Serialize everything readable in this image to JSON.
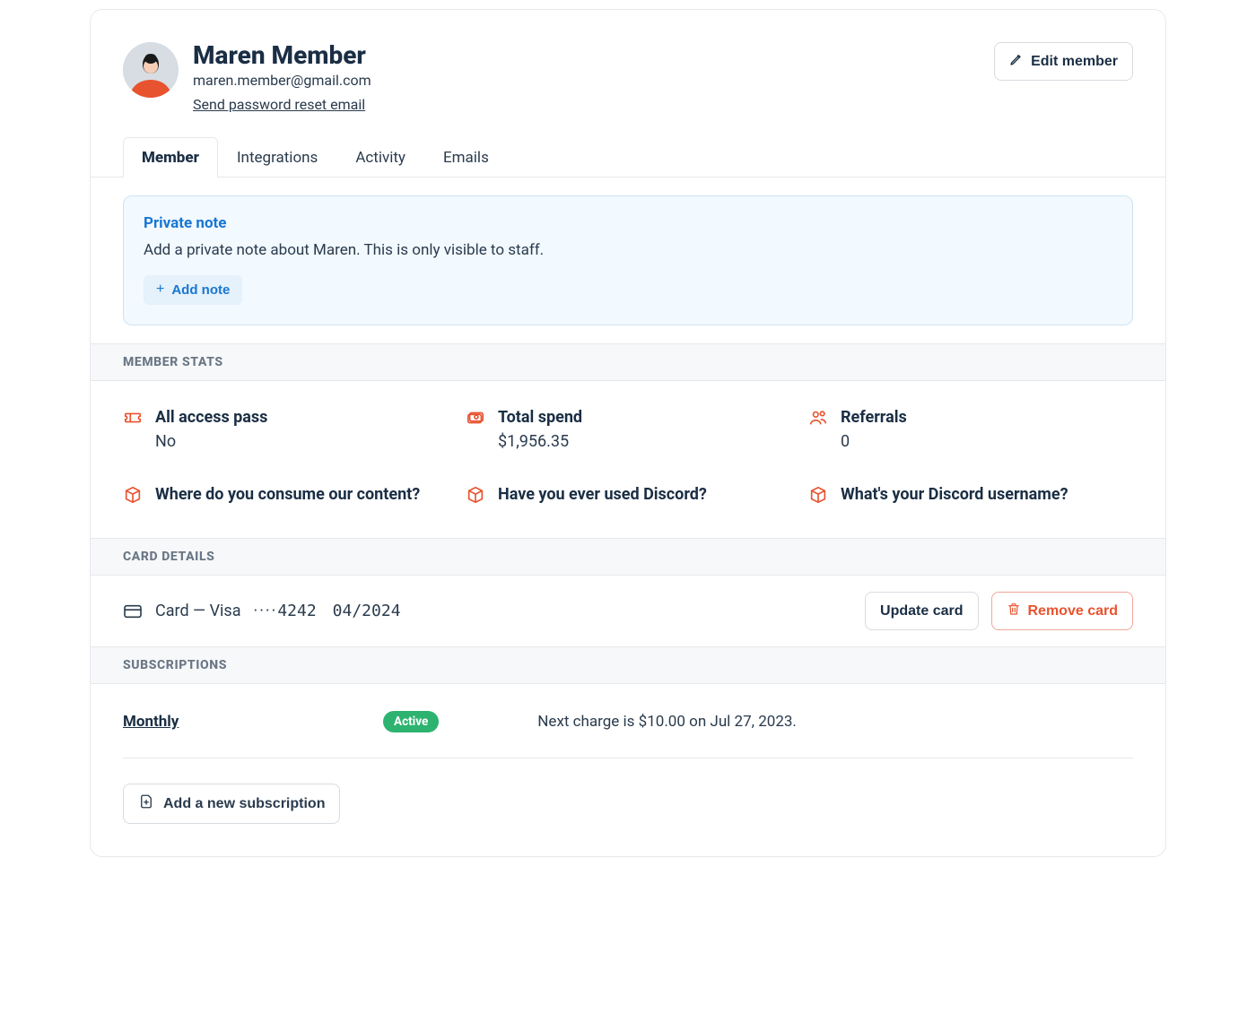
{
  "header": {
    "name": "Maren Member",
    "email": "maren.member@gmail.com",
    "reset_link": "Send password reset email",
    "edit_button": "Edit member"
  },
  "tabs": {
    "member": "Member",
    "integrations": "Integrations",
    "activity": "Activity",
    "emails": "Emails"
  },
  "note": {
    "title": "Private note",
    "description": "Add a private note about Maren. This is only visible to staff.",
    "add_button": "Add note"
  },
  "sections": {
    "member_stats": "MEMBER STATS",
    "card_details": "CARD DETAILS",
    "subscriptions": "SUBSCRIPTIONS"
  },
  "stats": {
    "all_access": {
      "label": "All access pass",
      "value": "No"
    },
    "total_spend": {
      "label": "Total spend",
      "value": "$1,956.35"
    },
    "referrals": {
      "label": "Referrals",
      "value": "0"
    },
    "q1": {
      "label": "Where do you consume our content?"
    },
    "q2": {
      "label": "Have you ever used Discord?"
    },
    "q3": {
      "label": "What's your Discord username?"
    }
  },
  "card": {
    "prefix": "Card — Visa",
    "dots": "····",
    "last4": "4242",
    "expiry": "04/2024",
    "update_button": "Update card",
    "remove_button": "Remove card"
  },
  "subscription": {
    "name": "Monthly",
    "badge": "Active",
    "next_charge": "Next charge is $10.00 on  Jul 27, 2023.",
    "add_button": "Add a new subscription"
  }
}
